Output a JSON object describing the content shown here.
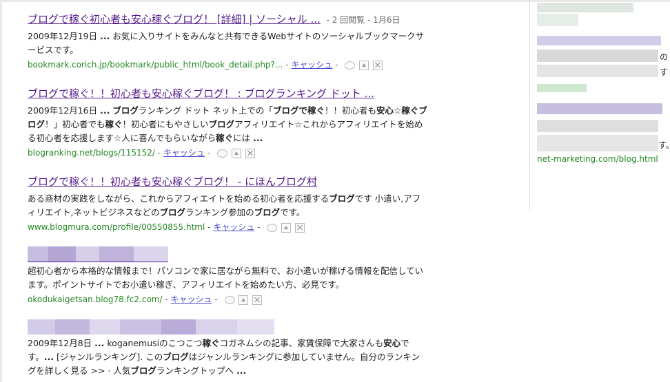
{
  "results": [
    {
      "title": "ブログで稼ぐ初心者も安心稼ぐブログ！ [詳細] | ソーシャル ...",
      "meta": "- 2 回閲覧 - 1月6日",
      "snippet_html": "2009年12月19日 <b>...</b> お気に入りサイトをみんなと共有できるWebサイトのソーシャルブックマークサービスです。",
      "cite": "bookmark.corich.jp/bookmark/public_html/book_detail.php?...",
      "cache": "キャッシュ"
    },
    {
      "title": "ブログで稼ぐ！！初心者も安心稼ぐブログ！ : ブログランキング ドット ...",
      "meta": "",
      "snippet_html": "2009年12月16日 <b>...</b> <b>ブログ</b>ランキング ドット ネット上での「<b>ブログで稼ぐ</b>！！初心者も<b>安心</b>☆<b>稼ぐブログ</b>！」初心者でも<b>稼ぐ</b>！初心者にもやさしい<b>ブログ</b>アフィリエイト☆これからアフィリエイトを始める初心者を応援します☆人に喜んでもらいながら<b>稼ぐ</b>には <b>...</b>",
      "cite": "blogranking.net/blogs/115152/",
      "cache": "キャッシュ"
    },
    {
      "title": "ブログで稼ぐ！！初心者も安心稼ぐブログ！ - にほんブログ村",
      "meta": "",
      "snippet_html": "ある商材の実践をしながら、これからアフィエイトを始める初心者を応援する<b>ブログ</b>です 小遣い,アフィリエイト,ネットビジネスなどの<b>ブログ</b>ランキング参加の<b>ブログ</b>です。",
      "cite": "www.blogmura.com/profile/00550855.html",
      "cache": "キャッシュ"
    },
    {
      "title": "",
      "meta": "",
      "snippet_html": "超初心者から本格的な情報まで！パソコンで家に居ながら無料で、お小遣いが稼げる情報を配信しています。ポイントサイトでお小遣い稼ぎ、アフィリエイトを始めたい方、必見です。",
      "cite": "okodukaigetsan.blog78.fc2.com/",
      "cache": "キャッシュ"
    },
    {
      "title": "",
      "meta": "",
      "snippet_html": "2009年12月8日 <b>...</b> koganemusiのこつこつ<b>稼ぐ</b>コガネムシの記事、家賃保障で大家さんも<b>安心</b>です。<b>...</b> [ジャンルランキング]. この<b>ブログ</b>はジャンルランキングに参加していません。自分のランキングを詳しく見る &gt;&gt; · 人気<b>ブログ</b>ランキングトップへ <b>...</b>",
      "cite": "",
      "cache": ""
    }
  ],
  "separator": "-",
  "sidebar": {
    "tail_1": "の",
    "tail_2": "す",
    "tail_3": "す。",
    "url": "net-marketing.com/blog.html"
  }
}
